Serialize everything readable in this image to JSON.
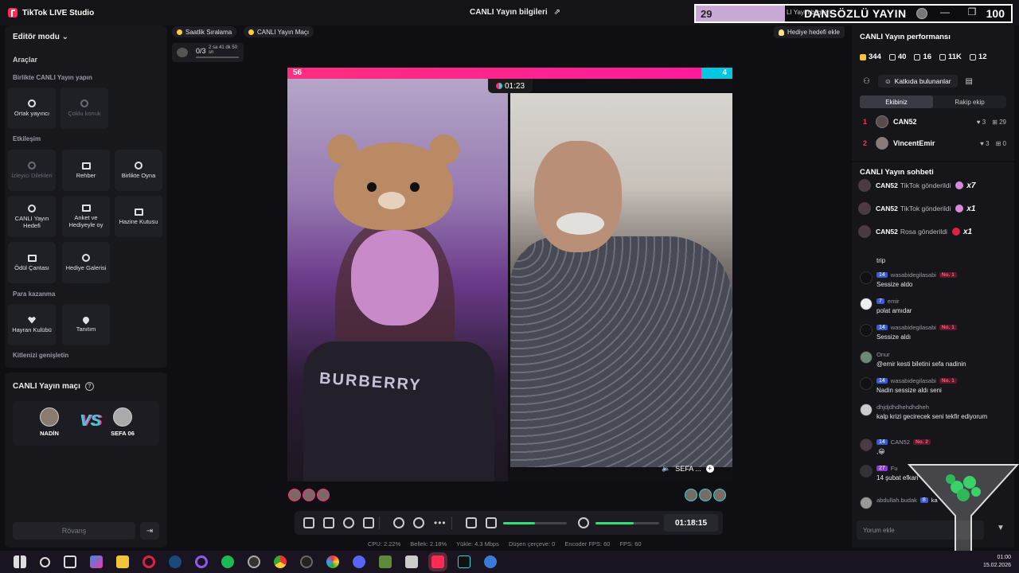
{
  "app": {
    "title": "TikTok LIVE Studio"
  },
  "header": {
    "center_title": "CANLI Yayın bilgileri"
  },
  "overlay": {
    "left_number": "29",
    "small_text": "LI Yayın bilgileri",
    "title": "DANSÖZLÜ YAYIN",
    "right_number": "100"
  },
  "left": {
    "mode": "Editör modu",
    "tools_title": "Araçlar",
    "sections": {
      "together": "Birlikte CANLI Yayın yapın",
      "interaction": "Etkileşim",
      "monetization": "Para kazanma",
      "expand": "Kitlenizi genişletin"
    },
    "tiles": {
      "cohost": "Ortak yayıncı",
      "multi_guest": "Çoklu konuk",
      "viewer_requests": "İzleyici Dilekleri",
      "guide": "Rehber",
      "play_together": "Birlikte Oyna",
      "live_goal": "CANLI Yayın Hedefi",
      "poll": "Anket ve Hediyeyle oy",
      "treasure": "Hazine Kutusu",
      "reward_bag": "Ödül Çantası",
      "gift_gallery": "Hediye Galerisi",
      "fan_club": "Hayran Kulübü",
      "promote": "Tanıtım"
    }
  },
  "match": {
    "title": "CANLI Yayın maçı",
    "player_left": "NADİN",
    "player_right": "SEFA 06",
    "vs": "VS",
    "rematch": "Rövanş"
  },
  "chips": {
    "hourly": "Saatlik Sıralama",
    "live_match": "CANLI Yayın Maçı",
    "goal": "Hediye hedefi ekle"
  },
  "timer_chip": {
    "count": "0/3",
    "time": "2 sa 41 dk 50 sn",
    "progress": 0.0
  },
  "battle": {
    "score_left": "56",
    "score_right": "4",
    "score_ratio": 0.93,
    "timer": "01:23",
    "guest_label": "SEFA ...",
    "shirt_text": "BURBERRY"
  },
  "controls": {
    "elapsed": "01:18:15",
    "audio_level": 0.5,
    "mic_level": 0.6
  },
  "stats": {
    "cpu": "CPU:  2.22%",
    "memory": "Bellek:  2.18%",
    "upload": "Yükle:  4.3 Mbps",
    "dropped": "Düşen çerçeve:  0",
    "encoder_fps": "Encoder FPS:  60",
    "fps": "FPS:  60"
  },
  "perf": {
    "title": "CANLI Yayın performansı",
    "coins": "344",
    "viewers": "40",
    "followers": "16",
    "likes": "11K",
    "gifts": "12",
    "contributors_btn": "Katkıda bulunanlar",
    "tab_team": "Ekibiniz",
    "tab_rival": "Rakip ekip",
    "ranks": [
      {
        "rank": "1",
        "name": "CAN52",
        "likes": "3",
        "gifts": "29"
      },
      {
        "rank": "2",
        "name": "VincentEmir",
        "likes": "3",
        "gifts": "0"
      }
    ]
  },
  "chat": {
    "title": "CANLI Yayın sohbeti",
    "gifts": [
      {
        "user": "CAN52",
        "text": "TikTok gönderildi",
        "count": "x7"
      },
      {
        "user": "CAN52",
        "text": "TikTok gönderildi",
        "count": "x1"
      },
      {
        "user": "CAN52",
        "text": "Rosa gönderildi",
        "count": "x1"
      }
    ],
    "messages": [
      {
        "user": "",
        "level": "",
        "badge": "",
        "text": "trip"
      },
      {
        "user": "wasabidegilasabi",
        "level": "14",
        "badge": "No. 1",
        "text": "Sessize aldo"
      },
      {
        "user": "emir",
        "level": "7",
        "badge": "",
        "text": "polat amıdar"
      },
      {
        "user": "wasabidegilasabi",
        "level": "14",
        "badge": "No. 1",
        "text": "Sessize aldı"
      },
      {
        "user": "Onur",
        "level": "",
        "badge": "",
        "text": "@emir kesti biletini sefa nadinin"
      },
      {
        "user": "wasabidegilasabi",
        "level": "14",
        "badge": "No. 1",
        "text": "Nadin sessize aldı seni"
      },
      {
        "user": "dhjdjdhdhehdhdheh",
        "level": "",
        "badge": "",
        "text": "kalp krizi gecirecek seni tekfir ediyorum"
      },
      {
        "user": "CAN52",
        "level": "14",
        "badge": "No. 2",
        "text": ",😀"
      },
      {
        "user": "Fu",
        "level": "27",
        "badge": "",
        "text": "14 şubat efkari"
      },
      {
        "user": "abdullah.budak",
        "level": "8",
        "badge": "",
        "text": "ka"
      }
    ],
    "input_placeholder": "Yorum ekle"
  },
  "taskbar": {
    "time": "01:00",
    "date": "15.02.2026"
  },
  "colors": {
    "accent_pink": "#ff2e7f",
    "accent_cyan": "#00c8e0",
    "panel": "#17171c"
  }
}
